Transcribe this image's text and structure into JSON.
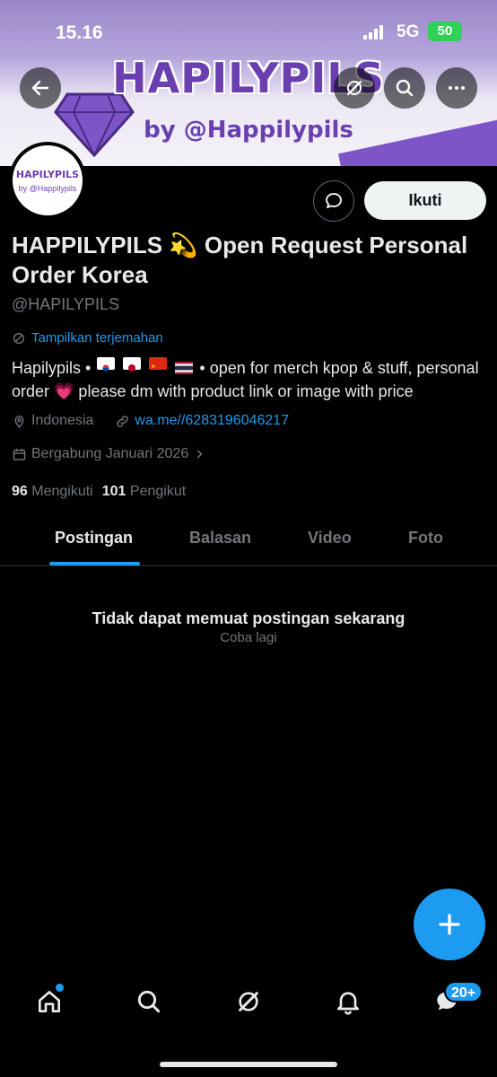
{
  "status_bar": {
    "time": "15.16",
    "network": "5G",
    "battery": "50"
  },
  "banner": {
    "brand": "HAPILYPILS",
    "byline": "by @Happilypils"
  },
  "avatar": {
    "line1": "HAPILYPILS",
    "line2": "by @Happilypils"
  },
  "actions": {
    "follow_label": "Ikuti"
  },
  "profile": {
    "name": "HAPPILYPILS 💫 Open Request Personal Order Korea",
    "handle": "@HAPILYPILS",
    "translate_label": "Tampilkan terjemahan",
    "bio_start": "Hapilypils •",
    "bio_end": "• open for merch kpop & stuff, personal order 💗  please dm with product link or image with price",
    "location": "Indonesia",
    "link": "wa.me//6283196046217",
    "joined": "Bergabung Januari 2026"
  },
  "stats": {
    "following_count": "96",
    "following_label": "Mengikuti",
    "followers_count": "101",
    "followers_label": "Pengikut"
  },
  "tabs": [
    {
      "label": "Postingan",
      "active": true
    },
    {
      "label": "Balasan",
      "active": false
    },
    {
      "label": "Video",
      "active": false
    },
    {
      "label": "Foto",
      "active": false
    }
  ],
  "empty_state": {
    "title": "Tidak dapat memuat postingan sekarang",
    "retry": "Coba lagi"
  },
  "bottom_nav": {
    "items": [
      "home-icon",
      "search-icon",
      "grok-icon",
      "bell-icon",
      "messages-icon"
    ],
    "messages_badge": "20+"
  },
  "colors": {
    "accent": "#1d9bf0",
    "background": "#000000",
    "muted": "#71767b",
    "brand_purple": "#6a3fb0"
  }
}
